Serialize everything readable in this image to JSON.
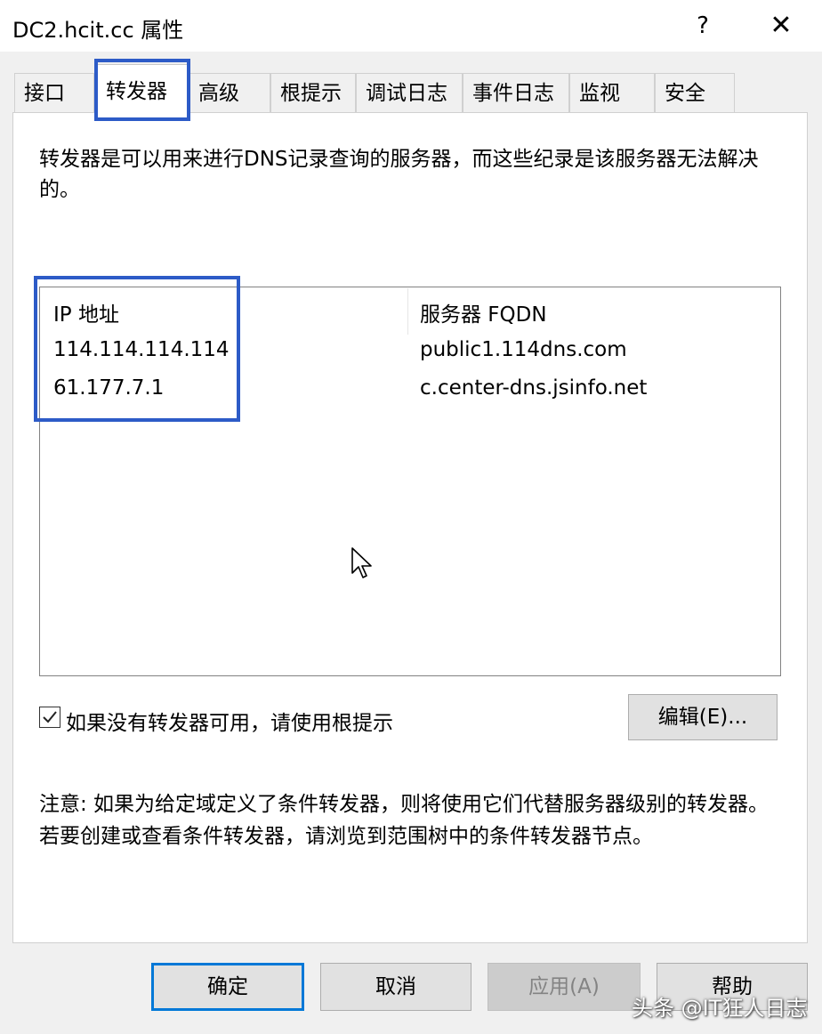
{
  "window": {
    "title": "DC2.hcit.cc 属性",
    "help_icon": "?",
    "close_icon": "✕"
  },
  "tabs": [
    "接口",
    "转发器",
    "高级",
    "根提示",
    "调试日志",
    "事件日志",
    "监视",
    "安全"
  ],
  "active_tab": "转发器",
  "description": "转发器是可以用来进行DNS记录查询的服务器，而这些纪录是该服务器无法解决的。",
  "forwarders": {
    "columns": [
      "IP 地址",
      "服务器 FQDN"
    ],
    "rows": [
      {
        "ip": "114.114.114.114",
        "fqdn": "public1.114dns.com"
      },
      {
        "ip": "61.177.7.1",
        "fqdn": "c.center-dns.jsinfo.net"
      }
    ]
  },
  "use_root_hints": {
    "checked": true,
    "label": "如果没有转发器可用，请使用根提示"
  },
  "edit_button": "编辑(E)...",
  "note": "注意: 如果为给定域定义了条件转发器，则将使用它们代替服务器级别的转发器。若要创建或查看条件转发器，请浏览到范围树中的条件转发器节点。",
  "buttons": {
    "ok": "确定",
    "cancel": "取消",
    "apply": "应用(A)",
    "help": "帮助"
  },
  "watermark": "头条 @IT狂人日志",
  "colors": {
    "highlight": "#2d5bc7",
    "focus": "#0078d7",
    "window_bg": "#f0f0f0"
  }
}
